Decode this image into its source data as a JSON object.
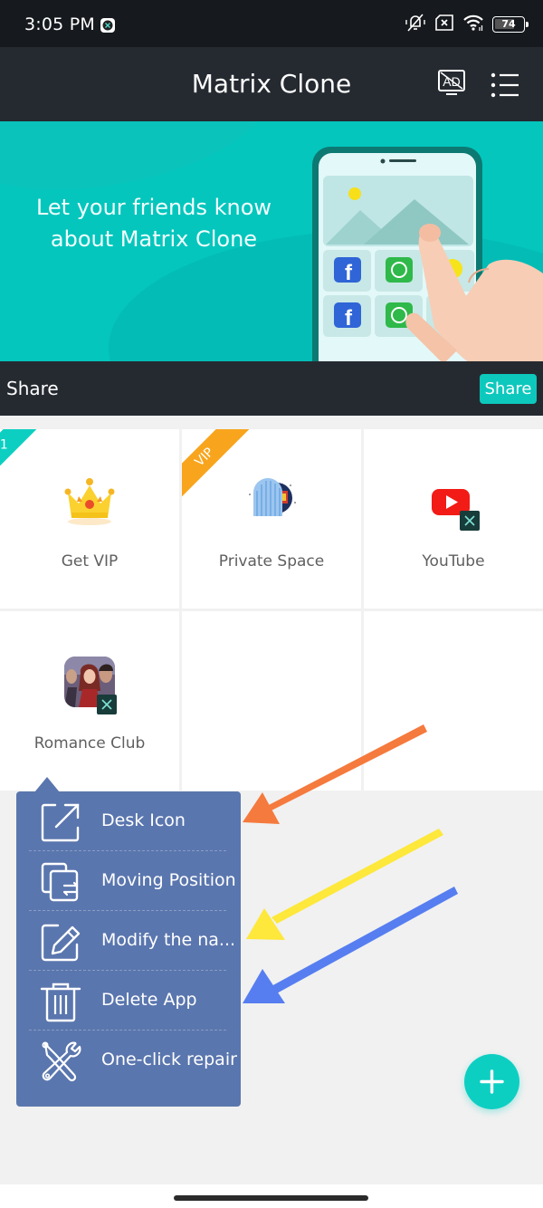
{
  "status_bar": {
    "time": "3:05 PM",
    "battery_level": "74",
    "battery_percent": 74,
    "icons": [
      "app-notification-icon",
      "vibrate-off-icon",
      "sim-missing-icon",
      "wifi-icon",
      "battery-icon"
    ]
  },
  "app_bar": {
    "title": "Matrix Clone",
    "ad_icon": "ad-block-icon",
    "menu_icon": "list-menu-icon"
  },
  "banner": {
    "text_line1": "Let your friends know",
    "text_line2": "about Matrix Clone"
  },
  "share_bar": {
    "label": "Share",
    "button_label": "Share"
  },
  "grid": {
    "cells": [
      {
        "label": "Get VIP",
        "icon": "crown-icon",
        "badge": "1",
        "badge_color": "#0ccfc2"
      },
      {
        "label": "Private Space",
        "icon": "private-space-icon",
        "badge": "VIP",
        "badge_color": "#f8a51d"
      },
      {
        "label": "YouTube",
        "icon": "youtube-icon",
        "cloned": true
      },
      {
        "label": "Romance Club",
        "icon": "romance-club-icon",
        "cloned": true
      },
      {
        "label": ""
      },
      {
        "label": ""
      }
    ]
  },
  "popup_menu": {
    "items": [
      {
        "label": "Desk Icon",
        "icon": "external-link-icon"
      },
      {
        "label": "Moving Position",
        "icon": "move-copy-icon"
      },
      {
        "label": "Modify the na...",
        "icon": "edit-icon"
      },
      {
        "label": "Delete App",
        "icon": "trash-icon"
      },
      {
        "label": "One-click repair",
        "icon": "repair-tools-icon"
      }
    ]
  },
  "annotations": {
    "arrows": [
      {
        "color": "#f57a3d",
        "points_to": "Desk Icon"
      },
      {
        "color": "#fde83b",
        "points_to": "Modify the na..."
      },
      {
        "color": "#567ef0",
        "points_to": "Delete App"
      }
    ]
  },
  "fab": {
    "icon": "plus-icon"
  },
  "colors": {
    "accent": "#0ccfc2",
    "dark_bar": "#252a31",
    "menu_bg": "#5a76ae",
    "vip_orange": "#f8a51d"
  }
}
